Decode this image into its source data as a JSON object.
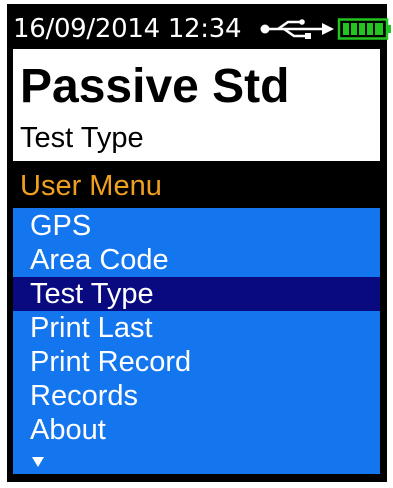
{
  "status_bar": {
    "datetime": "16/09/2014 12:34",
    "usb_icon": "usb-connected-icon",
    "battery_icon": "battery-full-icon",
    "battery_level": 1.0,
    "battery_color": "#22c51f"
  },
  "header": {
    "mode_title": "Passive Std",
    "current_setting": "Test Type"
  },
  "menu": {
    "title": "User Menu",
    "title_color": "#f0a020",
    "background_color": "#1476ef",
    "selected_color": "#0a0a80",
    "selected_index": 2,
    "items": [
      {
        "label": "GPS"
      },
      {
        "label": "Area Code"
      },
      {
        "label": "Test Type"
      },
      {
        "label": "Print Last"
      },
      {
        "label": "Print Record"
      },
      {
        "label": "Records"
      },
      {
        "label": "About"
      }
    ],
    "more_indicator": "scroll-down-arrow-icon"
  }
}
